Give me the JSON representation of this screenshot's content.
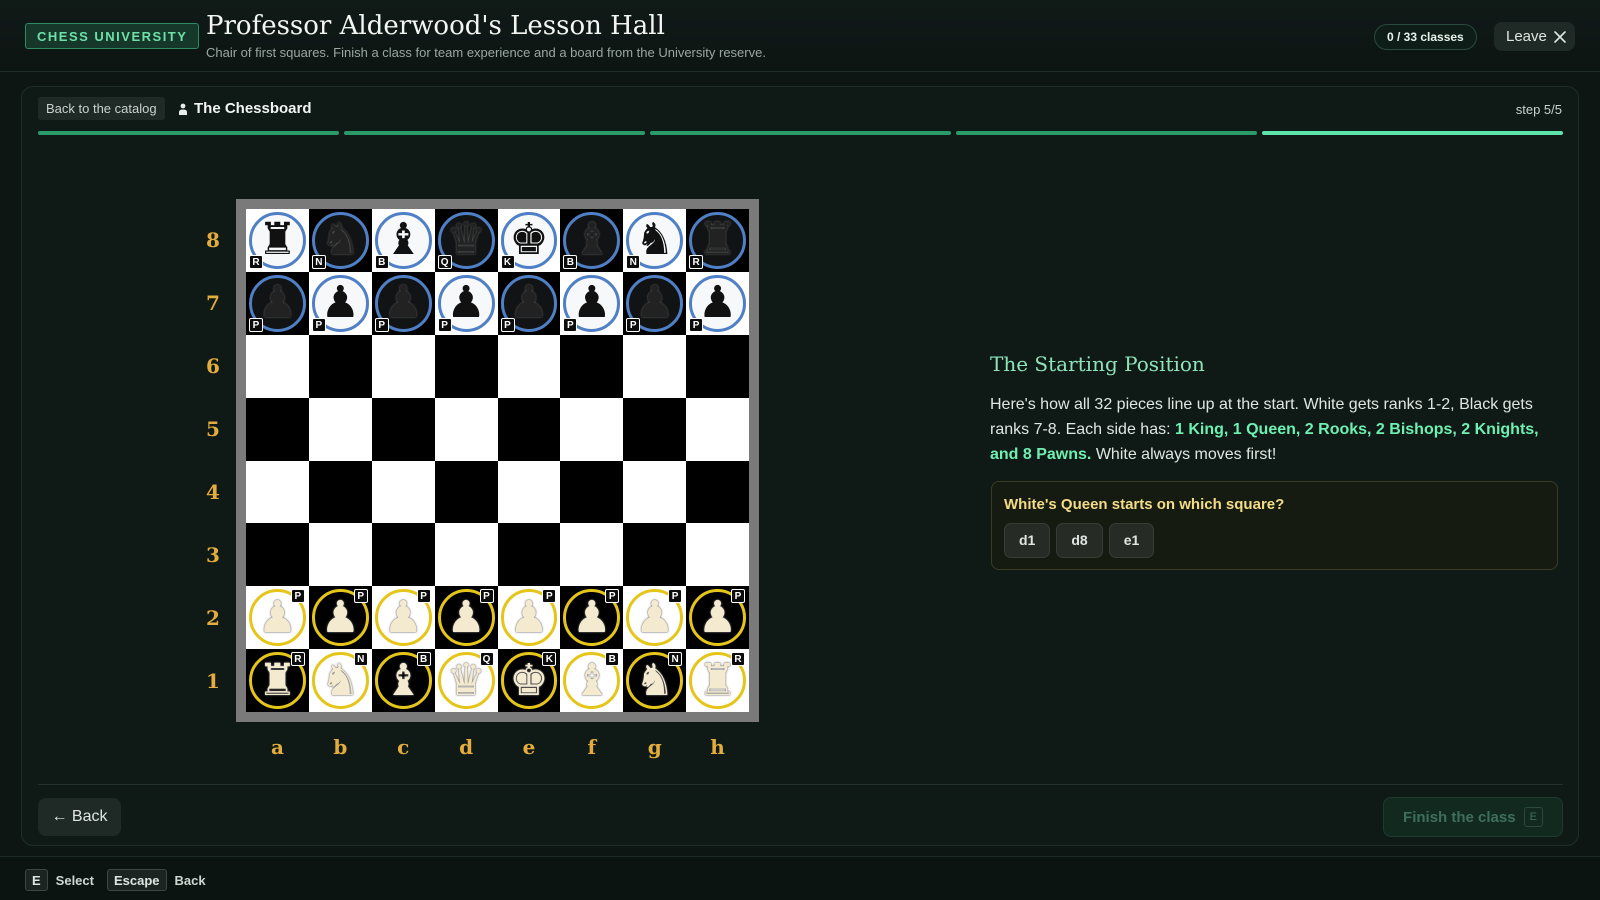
{
  "header": {
    "badge": "CHESS UNIVERSITY",
    "title": "Professor Alderwood's Lesson Hall",
    "subtitle": "Chair of first squares. Finish a class for team experience and a board from the University reserve.",
    "progress_counter": "0 / 33 classes",
    "leave_label": "Leave"
  },
  "lesson": {
    "back_label": "Back to the catalog",
    "title": "The Chessboard",
    "step_label": "step 5/5",
    "progress": {
      "current_step": 5,
      "total_steps": 5
    }
  },
  "board": {
    "files": [
      "a",
      "b",
      "c",
      "d",
      "e",
      "f",
      "g",
      "h"
    ],
    "ranks": [
      "8",
      "7",
      "6",
      "5",
      "4",
      "3",
      "2",
      "1"
    ],
    "rows": [
      [
        {
          "color": "black",
          "type": "rook",
          "symbol": "♜",
          "tag": "R"
        },
        {
          "color": "black",
          "type": "knight",
          "symbol": "♞",
          "tag": "N"
        },
        {
          "color": "black",
          "type": "bishop",
          "symbol": "♝",
          "tag": "B"
        },
        {
          "color": "black",
          "type": "queen",
          "symbol": "♛",
          "tag": "Q"
        },
        {
          "color": "black",
          "type": "king",
          "symbol": "♚",
          "tag": "K"
        },
        {
          "color": "black",
          "type": "bishop",
          "symbol": "♝",
          "tag": "B"
        },
        {
          "color": "black",
          "type": "knight",
          "symbol": "♞",
          "tag": "N"
        },
        {
          "color": "black",
          "type": "rook",
          "symbol": "♜",
          "tag": "R"
        }
      ],
      [
        {
          "color": "black",
          "type": "pawn",
          "symbol": "♟",
          "tag": "P"
        },
        {
          "color": "black",
          "type": "pawn",
          "symbol": "♟",
          "tag": "P"
        },
        {
          "color": "black",
          "type": "pawn",
          "symbol": "♟",
          "tag": "P"
        },
        {
          "color": "black",
          "type": "pawn",
          "symbol": "♟",
          "tag": "P"
        },
        {
          "color": "black",
          "type": "pawn",
          "symbol": "♟",
          "tag": "P"
        },
        {
          "color": "black",
          "type": "pawn",
          "symbol": "♟",
          "tag": "P"
        },
        {
          "color": "black",
          "type": "pawn",
          "symbol": "♟",
          "tag": "P"
        },
        {
          "color": "black",
          "type": "pawn",
          "symbol": "♟",
          "tag": "P"
        }
      ],
      [
        null,
        null,
        null,
        null,
        null,
        null,
        null,
        null
      ],
      [
        null,
        null,
        null,
        null,
        null,
        null,
        null,
        null
      ],
      [
        null,
        null,
        null,
        null,
        null,
        null,
        null,
        null
      ],
      [
        null,
        null,
        null,
        null,
        null,
        null,
        null,
        null
      ],
      [
        {
          "color": "white",
          "type": "pawn",
          "symbol": "♟",
          "tag": "P"
        },
        {
          "color": "white",
          "type": "pawn",
          "symbol": "♟",
          "tag": "P"
        },
        {
          "color": "white",
          "type": "pawn",
          "symbol": "♟",
          "tag": "P"
        },
        {
          "color": "white",
          "type": "pawn",
          "symbol": "♟",
          "tag": "P"
        },
        {
          "color": "white",
          "type": "pawn",
          "symbol": "♟",
          "tag": "P"
        },
        {
          "color": "white",
          "type": "pawn",
          "symbol": "♟",
          "tag": "P"
        },
        {
          "color": "white",
          "type": "pawn",
          "symbol": "♟",
          "tag": "P"
        },
        {
          "color": "white",
          "type": "pawn",
          "symbol": "♟",
          "tag": "P"
        }
      ],
      [
        {
          "color": "white",
          "type": "rook",
          "symbol": "♜",
          "tag": "R"
        },
        {
          "color": "white",
          "type": "knight",
          "symbol": "♞",
          "tag": "N"
        },
        {
          "color": "white",
          "type": "bishop",
          "symbol": "♝",
          "tag": "B"
        },
        {
          "color": "white",
          "type": "queen",
          "symbol": "♛",
          "tag": "Q"
        },
        {
          "color": "white",
          "type": "king",
          "symbol": "♚",
          "tag": "K"
        },
        {
          "color": "white",
          "type": "bishop",
          "symbol": "♝",
          "tag": "B"
        },
        {
          "color": "white",
          "type": "knight",
          "symbol": "♞",
          "tag": "N"
        },
        {
          "color": "white",
          "type": "rook",
          "symbol": "♜",
          "tag": "R"
        }
      ]
    ]
  },
  "info": {
    "title": "The Starting Position",
    "body_intro": "Here's how all 32 pieces line up at the start. White gets ranks 1-2, Black gets ranks 7-8. Each side has: ",
    "body_highlight": "1 King, 1 Queen, 2 Rooks, 2 Bishops, 2 Knights, and 8 Pawns.",
    "body_outro": " White always moves first!",
    "quiz": {
      "question": "White's Queen starts on which square?",
      "options": [
        "d1",
        "d8",
        "e1"
      ]
    }
  },
  "nav": {
    "back_label": "← Back",
    "finish_label": "Finish the class",
    "finish_key": "E"
  },
  "footer": {
    "select_key": "E",
    "select_label": "Select",
    "back_key": "Escape",
    "back_label": "Back"
  },
  "colors": {
    "accent": "#2a9a6b",
    "accent_bright": "#5fe3ad",
    "coordinate_label": "#e4ac3c",
    "black_piece_ring": "#4f7fc4",
    "white_piece_ring": "#e6c51a"
  },
  "icons": {
    "leave": "close-icon",
    "lesson": "person-icon"
  }
}
